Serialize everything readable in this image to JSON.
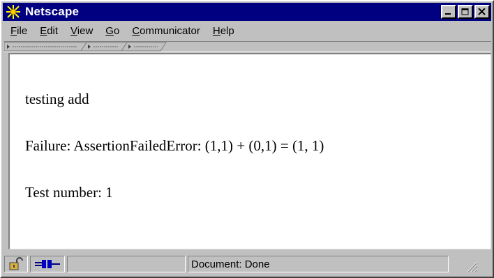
{
  "window": {
    "title": "Netscape"
  },
  "menu": {
    "items": [
      {
        "accel": "F",
        "rest": "ile"
      },
      {
        "accel": "E",
        "rest": "dit"
      },
      {
        "accel": "V",
        "rest": "iew"
      },
      {
        "accel": "G",
        "rest": "o"
      },
      {
        "accel": "C",
        "rest": "ommunicator"
      },
      {
        "accel": "H",
        "rest": "elp"
      }
    ]
  },
  "content": {
    "lines": [
      "testing add",
      "Failure: AssertionFailedError: (1,1) + (0,1) = (1, 1)",
      "Test number: 1"
    ]
  },
  "status": {
    "text": "Document: Done"
  },
  "icons": {
    "app": "netscape-logo-icon",
    "security": "padlock-icon",
    "connection": "plug-icon"
  },
  "colors": {
    "titlebar": "#000080",
    "chrome": "#c0c0c0",
    "page": "#ffffff"
  }
}
